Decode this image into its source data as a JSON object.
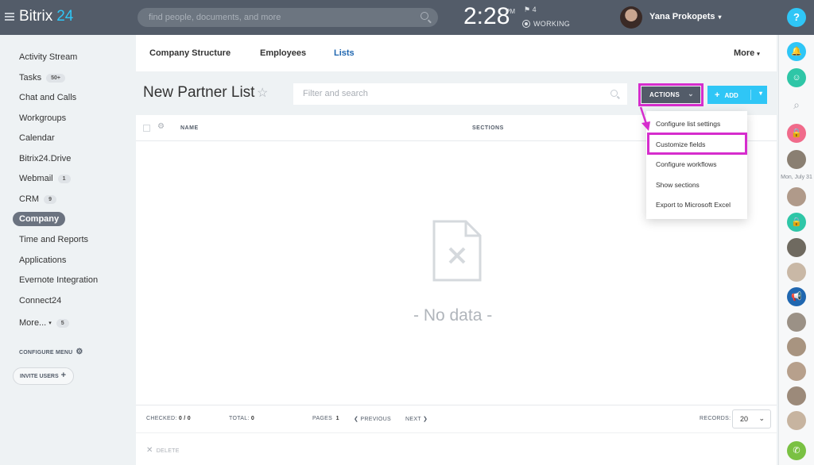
{
  "app": {
    "name": "Bitrix",
    "version": "24"
  },
  "search": {
    "placeholder": "find people, documents, and more"
  },
  "clock": {
    "time": "2:28",
    "ampm": "PM",
    "flags": "4",
    "status": "WORKING"
  },
  "user": {
    "name": "Yana Prokopets"
  },
  "sidebar": {
    "items": [
      {
        "label": "Activity Stream"
      },
      {
        "label": "Tasks",
        "badge": "50+"
      },
      {
        "label": "Chat and Calls"
      },
      {
        "label": "Workgroups"
      },
      {
        "label": "Calendar"
      },
      {
        "label": "Bitrix24.Drive"
      },
      {
        "label": "Webmail",
        "badge": "1"
      },
      {
        "label": "CRM",
        "badge": "9"
      },
      {
        "label": "Company",
        "active": true
      },
      {
        "label": "Time and Reports"
      },
      {
        "label": "Applications"
      },
      {
        "label": "Evernote Integration"
      },
      {
        "label": "Connect24"
      },
      {
        "label": "More...",
        "badge": "5"
      }
    ],
    "configure": "CONFIGURE MENU",
    "invite": "INVITE USERS"
  },
  "tabs": {
    "company": "Company Structure",
    "employees": "Employees",
    "lists": "Lists",
    "more": "More"
  },
  "page": {
    "title": "New Partner List",
    "filter_placeholder": "Filter and search"
  },
  "toolbar": {
    "actions": "ACTIONS",
    "add": "ADD"
  },
  "table": {
    "columns": {
      "name": "NAME",
      "sections": "SECTIONS"
    },
    "empty": "- No data -"
  },
  "footer": {
    "checked_label": "CHECKED:",
    "checked_value": "0 / 0",
    "total_label": "TOTAL:",
    "total_value": "0",
    "pages_label": "PAGES",
    "pages_value": "1",
    "previous": "PREVIOUS",
    "next": "NEXT",
    "records_label": "RECORDS:",
    "records_value": "20",
    "delete": "DELETE"
  },
  "menu": {
    "items": [
      "Configure list settings",
      "Customize fields",
      "Configure workflows",
      "Show sections",
      "Export to Microsoft Excel"
    ]
  },
  "rightbar": {
    "date": "Mon, July 31",
    "help": "?"
  },
  "colors": {
    "topbar": "#535c69",
    "accent": "#2fc6f6",
    "link": "#2067b0",
    "highlight": "#d62dcd"
  }
}
